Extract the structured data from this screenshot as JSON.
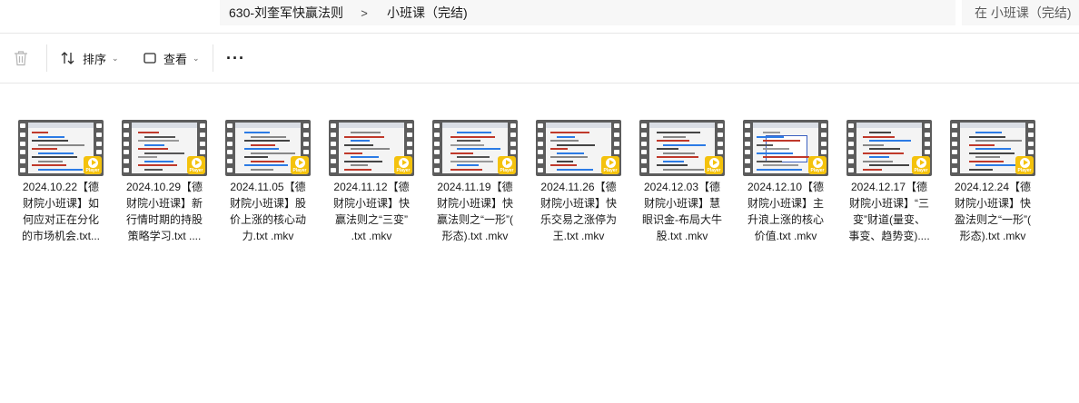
{
  "breadcrumb": {
    "items": [
      "630-刘奎军快赢法则",
      "小班课（完结)"
    ],
    "separator": ">"
  },
  "search": {
    "placeholder": "在 小班课（完结)"
  },
  "toolbar": {
    "delete_icon": "trash-icon",
    "sort_label": "排序",
    "view_label": "查看",
    "more_label": "···"
  },
  "files": [
    {
      "lines": [
        "2024.10.22【德",
        "财院小班课】如",
        "何应对正在分化",
        "的市场机会.txt..."
      ],
      "badge": "Player"
    },
    {
      "lines": [
        "2024.10.29【德",
        "财院小班课】新",
        "行情时期的持股",
        "策略学习.txt ...."
      ],
      "badge": "Player"
    },
    {
      "lines": [
        "2024.11.05【德",
        "财院小班课】股",
        "价上涨的核心动",
        "力.txt .mkv"
      ],
      "badge": "Player"
    },
    {
      "lines": [
        "2024.11.12【德",
        "财院小班课】快",
        "赢法则之“三变”",
        ".txt .mkv"
      ],
      "badge": "Player"
    },
    {
      "lines": [
        "2024.11.19【德",
        "财院小班课】快",
        "赢法则之“一形”(",
        "形态).txt .mkv"
      ],
      "badge": "Player"
    },
    {
      "lines": [
        "2024.11.26【德",
        "财院小班课】快",
        "乐交易之涨停为",
        "王.txt .mkv"
      ],
      "badge": "Player"
    },
    {
      "lines": [
        "2024.12.03【德",
        "财院小班课】慧",
        "眼识金-布局大牛",
        "股.txt .mkv"
      ],
      "badge": "Player"
    },
    {
      "lines": [
        "2024.12.10【德",
        "财院小班课】主",
        "升浪上涨的核心",
        "价值.txt .mkv"
      ],
      "badge": "Player"
    },
    {
      "lines": [
        "2024.12.17【德",
        "财院小班课】“三",
        "变”财道(量变、",
        "事变、趋势变)...."
      ],
      "badge": "Player"
    },
    {
      "lines": [
        "2024.12.24【德",
        "财院小班课】快",
        "盈法则之“一形”(",
        "形态).txt .mkv"
      ],
      "badge": "Player"
    }
  ],
  "colors": {
    "accent_badge": "#f4c20d",
    "film": "#5c5c5c"
  }
}
